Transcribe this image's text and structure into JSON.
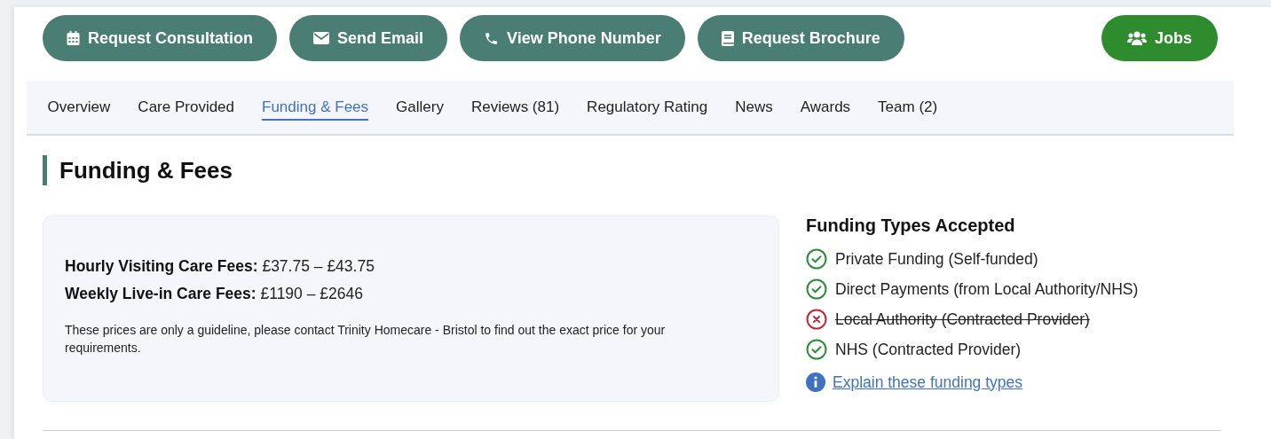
{
  "actions": [
    {
      "label": "Request Consultation",
      "kind": "primary"
    },
    {
      "label": "Send Email",
      "kind": "primary"
    },
    {
      "label": "View Phone Number",
      "kind": "primary"
    },
    {
      "label": "Request Brochure",
      "kind": "primary"
    },
    {
      "label": "Jobs",
      "kind": "jobs"
    }
  ],
  "tabs": [
    {
      "label": "Overview",
      "selected": false
    },
    {
      "label": "Care Provided",
      "selected": false
    },
    {
      "label": "Funding & Fees",
      "selected": true
    },
    {
      "label": "Gallery",
      "selected": false
    },
    {
      "label": "Reviews (81)",
      "selected": false
    },
    {
      "label": "Regulatory Rating",
      "selected": false
    },
    {
      "label": "News",
      "selected": false
    },
    {
      "label": "Awards",
      "selected": false
    },
    {
      "label": "Team (2)",
      "selected": false
    }
  ],
  "section_title": "Funding & Fees",
  "fees": [
    {
      "label": "Hourly Visiting Care Fees:",
      "value": "£37.75 – £43.75"
    },
    {
      "label": "Weekly Live-in Care Fees:",
      "value": "£1190 – £2646"
    }
  ],
  "fees_note": "These prices are only a guideline, please contact Trinity Homecare - Bristol to find out the exact price for your requirements.",
  "funding_types": {
    "title": "Funding Types Accepted",
    "items": [
      {
        "label": "Private Funding (Self-funded)",
        "accepted": true
      },
      {
        "label": "Direct Payments (from Local Authority/NHS)",
        "accepted": true
      },
      {
        "label": "Local Authority (Contracted Provider)",
        "accepted": false
      },
      {
        "label": "NHS (Contracted Provider)",
        "accepted": true
      }
    ],
    "link": "Explain these funding types"
  }
}
